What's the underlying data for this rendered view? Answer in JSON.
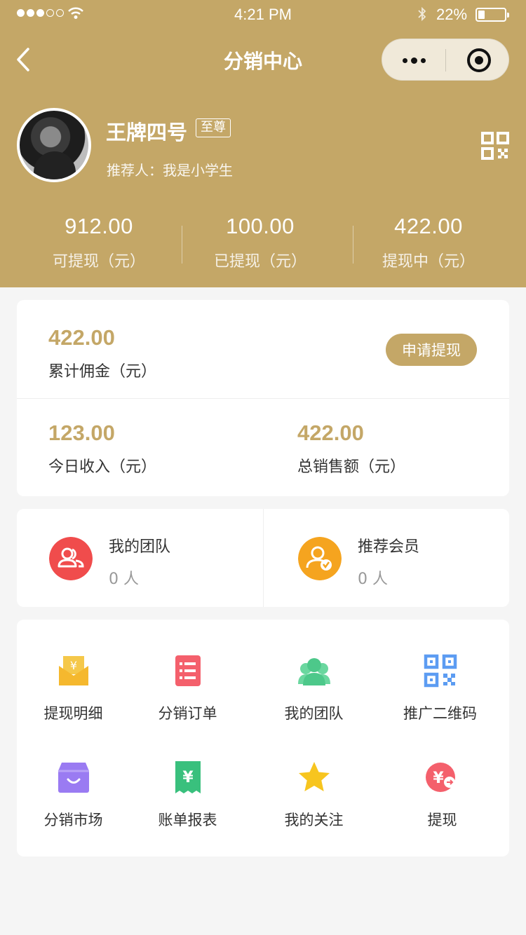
{
  "status_bar": {
    "time": "4:21 PM",
    "battery": "22%"
  },
  "nav": {
    "title": "分销中心"
  },
  "user": {
    "name": "王牌四号",
    "level": "至尊",
    "referrer": "推荐人：我是小学生"
  },
  "balance": [
    {
      "value": "912.00",
      "label": "可提现（元）"
    },
    {
      "value": "100.00",
      "label": "已提现（元）"
    },
    {
      "value": "422.00",
      "label": "提现中（元）"
    }
  ],
  "commission": {
    "total_value": "422.00",
    "total_label": "累计佣金（元）",
    "apply_button": "申请提现",
    "today_value": "123.00",
    "today_label": "今日收入（元）",
    "sales_value": "422.00",
    "sales_label": "总销售额（元）"
  },
  "team": {
    "my_team_label": "我的团队",
    "my_team_count": "0 人",
    "referrals_label": "推荐会员",
    "referrals_count": "0 人"
  },
  "menu": [
    {
      "label": "提现明细",
      "icon": "withdraw-detail-icon",
      "color": "#f5b82e"
    },
    {
      "label": "分销订单",
      "icon": "order-list-icon",
      "color": "#f4606c"
    },
    {
      "label": "我的团队",
      "icon": "team-icon",
      "color": "#4dc88a"
    },
    {
      "label": "推广二维码",
      "icon": "qr-code-icon",
      "color": "#5c9cf2"
    },
    {
      "label": "分销市场",
      "icon": "market-icon",
      "color": "#9a7bf2"
    },
    {
      "label": "账单报表",
      "icon": "bill-report-icon",
      "color": "#39c07d"
    },
    {
      "label": "我的关注",
      "icon": "star-icon",
      "color": "#f7c51f"
    },
    {
      "label": "提现",
      "icon": "cash-out-icon",
      "color": "#f4606c"
    }
  ],
  "colors": {
    "header": "#c4a767",
    "accent": "#c4a767",
    "background": "#f5f5f5"
  }
}
